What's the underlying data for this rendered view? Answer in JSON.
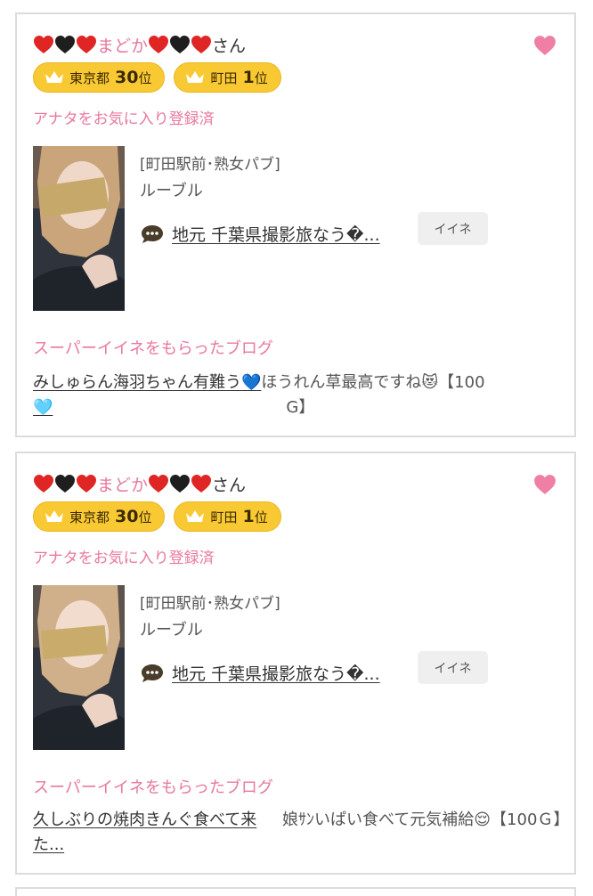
{
  "cards": [
    {
      "name_prefix": "まどか",
      "name_suffix": "さん",
      "badges": [
        {
          "area": "東京都",
          "rank": "30",
          "unit": "位"
        },
        {
          "area": "町田",
          "rank": "1",
          "unit": "位"
        }
      ],
      "favorite_status": "アナタをお気に入り登録済",
      "shop_category": "[町田駅前･熟女パブ]",
      "shop_name": "ルーブル",
      "blog_title": "地元 千葉県撮影旅なう�...",
      "iine_label": "イイネ",
      "super_title": "スーパーイイネをもらったブログ",
      "super_blog_link": "みしゅらん海羽ちゃん有難う💙",
      "super_comment": "ほうれん草最高ですね😻【100",
      "super_comment_2": "G】",
      "super_blog_link_2": "🩵"
    },
    {
      "name_prefix": "まどか",
      "name_suffix": "さん",
      "badges": [
        {
          "area": "東京都",
          "rank": "30",
          "unit": "位"
        },
        {
          "area": "町田",
          "rank": "1",
          "unit": "位"
        }
      ],
      "favorite_status": "アナタをお気に入り登録済",
      "shop_category": "[町田駅前･熟女パブ]",
      "shop_name": "ルーブル",
      "blog_title": "地元 千葉県撮影旅なう�...",
      "iine_label": "イイネ",
      "super_title": "スーパーイイネをもらったブログ",
      "super_blog_link": "久しぶりの焼肉きんぐ食べて来た...",
      "super_comment": "娘ｻﾝいぱい食べて元気補給😌【100Ｇ】"
    }
  ],
  "colors": {
    "pink": "#e8789e",
    "badge_yellow": "#f9c934",
    "heart_red": "#e02525",
    "heart_black": "#1e1e1e",
    "border": "#dcdcdc"
  },
  "icons": [
    "red-heart-icon",
    "black-heart-icon",
    "favorite-heart-icon",
    "crown-icon",
    "speech-bubble-icon"
  ]
}
